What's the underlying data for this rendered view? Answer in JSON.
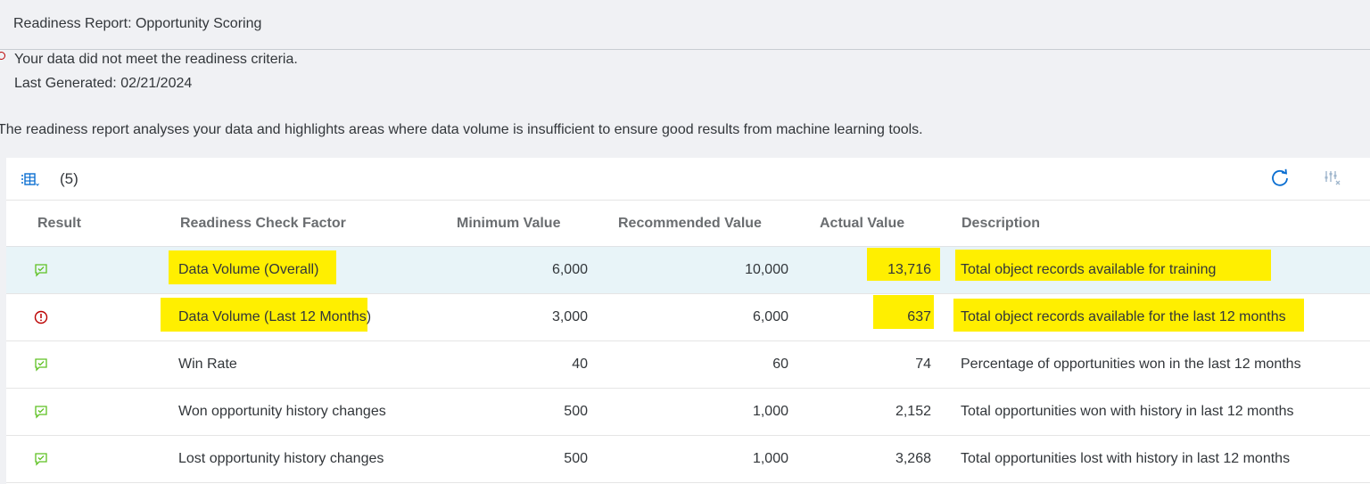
{
  "page": {
    "title": "Readiness Report: Opportunity Scoring",
    "status_message": "Your data did not meet the readiness criteria.",
    "last_generated": "Last Generated: 02/21/2024",
    "intro": "The readiness report analyses your data and highlights areas where data volume is insufficient to ensure good results from machine learning tools."
  },
  "toolbar": {
    "count": "(5)",
    "view_icon": "table-view-icon",
    "refresh_icon": "refresh-icon",
    "settings_icon": "table-settings-icon"
  },
  "columns": {
    "result": "Result",
    "factor": "Readiness Check Factor",
    "minimum": "Minimum Value",
    "recommended": "Recommended Value",
    "actual": "Actual Value",
    "description": "Description"
  },
  "rows": [
    {
      "result": "pass",
      "factor": "Data Volume (Overall)",
      "minimum": "6,000",
      "recommended": "10,000",
      "actual": "13,716",
      "description": "Total object records available for training"
    },
    {
      "result": "fail",
      "factor": "Data Volume (Last 12 Months)",
      "minimum": "3,000",
      "recommended": "6,000",
      "actual": "637",
      "description": "Total object records available for the last 12 months"
    },
    {
      "result": "pass",
      "factor": "Win Rate",
      "minimum": "40",
      "recommended": "60",
      "actual": "74",
      "description": "Percentage of opportunities won in the last 12 months"
    },
    {
      "result": "pass",
      "factor": "Won opportunity history changes",
      "minimum": "500",
      "recommended": "1,000",
      "actual": "2,152",
      "description": "Total opportunities won with history in last 12 months"
    },
    {
      "result": "pass",
      "factor": "Lost opportunity history changes",
      "minimum": "500",
      "recommended": "1,000",
      "actual": "3,268",
      "description": "Total opportunities lost with history in last 12 months"
    }
  ],
  "colors": {
    "success": "#5dc122",
    "error": "#bb0000",
    "highlight": "#ffef00",
    "selected_row": "#e8f4f8"
  }
}
